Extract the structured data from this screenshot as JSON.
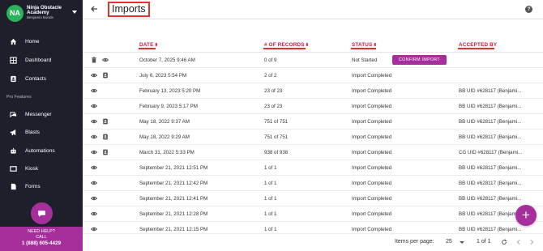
{
  "account": {
    "initials": "NA",
    "org_name_line1": "Ninja Obstacle",
    "org_name_line2": "Academy",
    "user_name": "Benjamin Bonds"
  },
  "nav": {
    "home": "Home",
    "dashboard": "Dashboard",
    "contacts": "Contacts",
    "section_label": "Pro Features",
    "messenger": "Messenger",
    "blasts": "Blasts",
    "automations": "Automations",
    "kiosk": "Kiosk",
    "forms": "Forms"
  },
  "help": {
    "title": "NEED HELP?",
    "call": "CALL",
    "phone": "1 (888) 605-4429"
  },
  "header": {
    "title": "Imports",
    "help_icon": "?"
  },
  "table": {
    "columns": {
      "date": "DATE",
      "records": "# OF RECORDS",
      "status": "STATUS",
      "accepted_by": "ACCEPTED BY"
    },
    "rows": [
      {
        "date": "October 7, 2025 9:46 AM",
        "records": "0 of 9",
        "status": "Not Started",
        "accepted_by": "",
        "action": "CONFIRM IMPORT",
        "icons": [
          "trash-icon",
          "eye-icon"
        ]
      },
      {
        "date": "July 6, 2023 5:54 PM",
        "records": "2 of 2",
        "status": "Import Completed",
        "accepted_by": "",
        "icons": [
          "eye-icon",
          "contact-card-icon"
        ]
      },
      {
        "date": "February 13, 2023 5:20 PM",
        "records": "23 of 23",
        "status": "Import Completed",
        "accepted_by": "BB UID #628117 (Benjami...",
        "icons": [
          "eye-icon"
        ]
      },
      {
        "date": "February 9, 2023 5:17 PM",
        "records": "23 of 23",
        "status": "Import Completed",
        "accepted_by": "BB UID #628117 (Benjami...",
        "icons": [
          "eye-icon"
        ]
      },
      {
        "date": "May 18, 2022 9:37 AM",
        "records": "751 of 751",
        "status": "Import Completed",
        "accepted_by": "BB UID #628117 (Benjami...",
        "icons": [
          "eye-icon",
          "contact-card-icon"
        ]
      },
      {
        "date": "May 18, 2022 9:29 AM",
        "records": "751 of 751",
        "status": "Import Completed",
        "accepted_by": "BB UID #628117 (Benjami...",
        "icons": [
          "eye-icon",
          "contact-card-icon"
        ]
      },
      {
        "date": "March 31, 2022 5:33 PM",
        "records": "938 of 938",
        "status": "Import Completed",
        "accepted_by": "CG UID #628117 (Benjami...",
        "icons": [
          "eye-icon",
          "contact-card-icon"
        ]
      },
      {
        "date": "September 21, 2021 12:51 PM",
        "records": "1 of 1",
        "status": "Import Completed",
        "accepted_by": "BB UID #628117 (Benjami...",
        "icons": [
          "eye-icon"
        ]
      },
      {
        "date": "September 21, 2021 12:42 PM",
        "records": "1 of 1",
        "status": "Import Completed",
        "accepted_by": "BB UID #628117 (Benjami...",
        "icons": [
          "eye-icon"
        ]
      },
      {
        "date": "September 21, 2021 12:41 PM",
        "records": "1 of 1",
        "status": "Import Completed",
        "accepted_by": "BB UID #628117 (Benjami...",
        "icons": [
          "eye-icon"
        ]
      },
      {
        "date": "September 21, 2021 12:28 PM",
        "records": "1 of 1",
        "status": "Import Completed",
        "accepted_by": "BB UID #628117 (Benjami...",
        "icons": [
          "eye-icon"
        ]
      },
      {
        "date": "September 21, 2021 12:15 PM",
        "records": "1 of 1",
        "status": "Import Completed",
        "accepted_by": "BB UID #628117 (Benjami...",
        "icons": [
          "eye-icon"
        ]
      }
    ]
  },
  "pagination": {
    "items_per_page_label": "Items per page:",
    "items_per_page_value": "25",
    "page_range": "1 of 1"
  },
  "add_button": "+",
  "colors": {
    "sidebar_bg": "#1f1f2b",
    "accent": "#a62f9c",
    "header_text": "#c41a3c",
    "highlight": "#e53030",
    "avatar": "#29b35a"
  }
}
